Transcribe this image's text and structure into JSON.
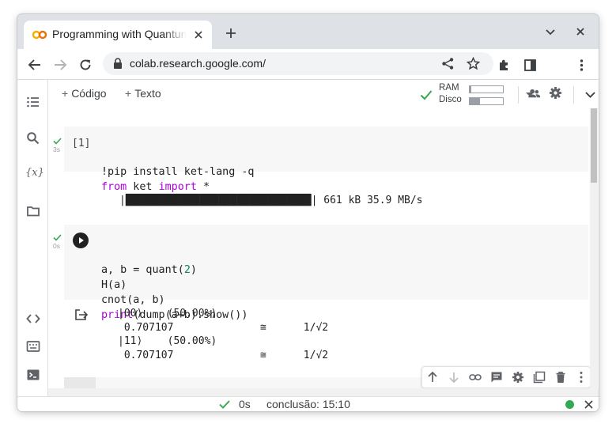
{
  "browser": {
    "tab_title": "Programming with Quantum",
    "url": "colab.research.google.com/"
  },
  "colab": {
    "toolbar": {
      "code_button": "Código",
      "text_button": "Texto",
      "ram_label": "RAM",
      "disk_label": "Disco",
      "ram_usage_fraction": 0.05,
      "disk_usage_fraction": 0.3
    },
    "cells": [
      {
        "exec_label": "[1]",
        "time": "3s",
        "code_lines": [
          [
            {
              "t": "!pip install ket-lang -q",
              "c": ""
            }
          ],
          [
            {
              "t": "from",
              "c": "kw"
            },
            {
              "t": " ket ",
              "c": ""
            },
            {
              "t": "import",
              "c": "kw"
            },
            {
              "t": " *",
              "c": ""
            }
          ]
        ],
        "output": "|██████████████████████████████| 661 kB 35.9 MB/s"
      },
      {
        "time": "0s",
        "code_lines": [
          [
            {
              "t": "a, b = quant(",
              "c": ""
            },
            {
              "t": "2",
              "c": "num"
            },
            {
              "t": ")",
              "c": ""
            }
          ],
          [
            {
              "t": "H(a)",
              "c": ""
            }
          ],
          [
            {
              "t": "cnot(a, b)",
              "c": ""
            }
          ],
          [
            {
              "t": "print",
              "c": "kw"
            },
            {
              "t": "(dump(a+b).show())",
              "c": ""
            }
          ]
        ],
        "output_lines": [
          "|00⟩    (50.00%)",
          " 0.707107              ≅      1/√2",
          "|11⟩    (50.00%)",
          " 0.707107              ≅      1/√2"
        ]
      }
    ],
    "statusbar": {
      "duration": "0s",
      "completion": "conclusão: 15:10"
    }
  },
  "colors": {
    "accent_green": "#34a853",
    "keyword_purple": "#af00db"
  }
}
